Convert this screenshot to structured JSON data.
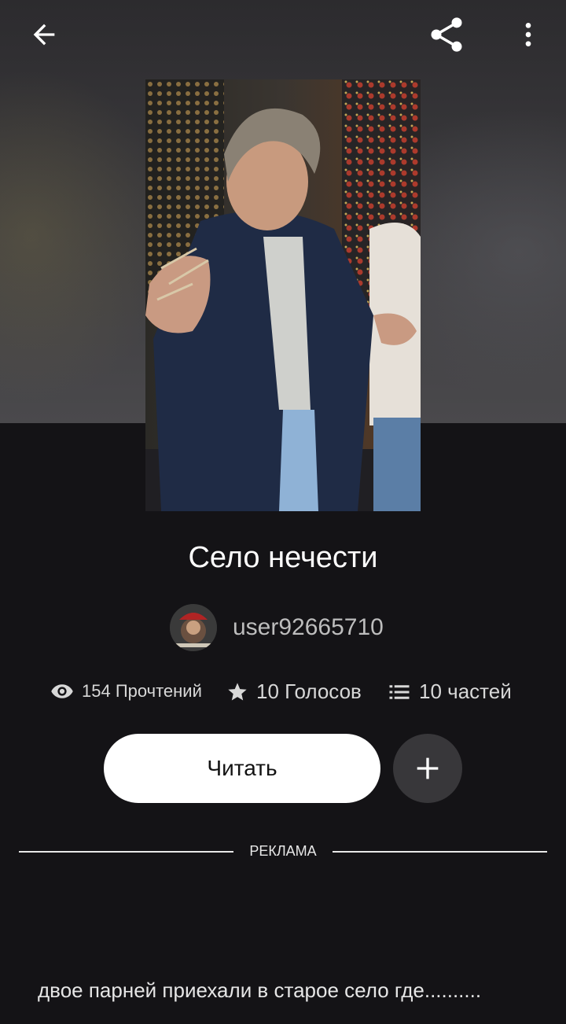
{
  "header": {
    "back_icon": "arrow-left-icon",
    "share_icon": "share-icon",
    "more_icon": "more-vertical-icon"
  },
  "story": {
    "title": "Село нечести",
    "author": "user92665710",
    "stats": {
      "reads": "154 Прочтений",
      "votes": "10 Голосов",
      "parts": "10 частей"
    },
    "read_button": "Читать",
    "add_icon": "plus-icon",
    "ad_label": "РЕКЛАМА",
    "description": "двое парней приехали в старое село где.........."
  },
  "colors": {
    "background": "#141316",
    "primary_button": "#ffffff",
    "secondary_button": "#38373a"
  }
}
